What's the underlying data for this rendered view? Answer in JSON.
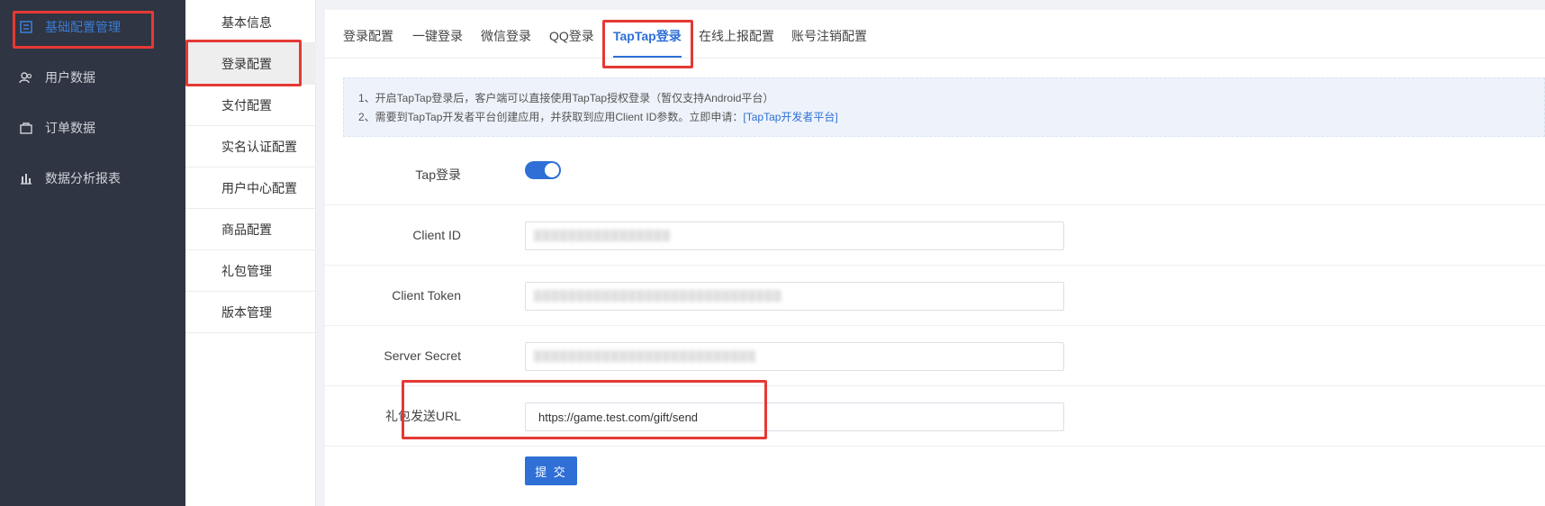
{
  "sidebar": {
    "items": [
      {
        "label": "基础配置管理",
        "icon": "config-icon",
        "active": true
      },
      {
        "label": "用户数据",
        "icon": "users-icon",
        "active": false
      },
      {
        "label": "订单数据",
        "icon": "order-icon",
        "active": false
      },
      {
        "label": "数据分析报表",
        "icon": "chart-icon",
        "active": false
      }
    ]
  },
  "submenu": {
    "items": [
      {
        "label": "基本信息"
      },
      {
        "label": "登录配置"
      },
      {
        "label": "支付配置"
      },
      {
        "label": "实名认证配置"
      },
      {
        "label": "用户中心配置"
      },
      {
        "label": "商品配置"
      },
      {
        "label": "礼包管理"
      },
      {
        "label": "版本管理"
      }
    ]
  },
  "tabs": [
    {
      "label": "登录配置"
    },
    {
      "label": "一键登录"
    },
    {
      "label": "微信登录"
    },
    {
      "label": "QQ登录"
    },
    {
      "label": "TapTap登录"
    },
    {
      "label": "在线上报配置"
    },
    {
      "label": "账号注销配置"
    }
  ],
  "notice": {
    "line1": "1、开启TapTap登录后，客户端可以直接使用TapTap授权登录（暂仅支持Android平台）",
    "line2_prefix": "2、需要到TapTap开发者平台创建应用，并获取到应用Client ID参数。立即申请：",
    "line2_link": "[TapTap开发者平台]"
  },
  "form": {
    "tap_login_label": "Tap登录",
    "tap_login_enabled": true,
    "client_id_label": "Client ID",
    "client_token_label": "Client Token",
    "server_secret_label": "Server Secret",
    "gift_url_label": "礼包发送URL",
    "gift_url_value": "https://game.test.com/gift/send",
    "submit_label": "提 交"
  },
  "colors": {
    "accent": "#2f6fd6",
    "sidebar_bg": "#2f3542",
    "highlight": "#e53935"
  }
}
